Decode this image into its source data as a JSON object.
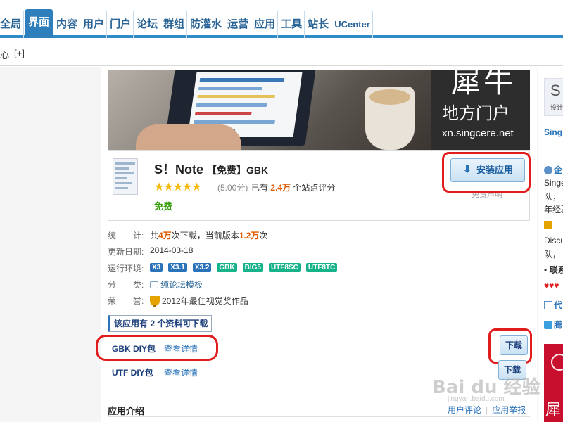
{
  "nav": {
    "tabs": [
      "全局",
      "界面",
      "内容",
      "用户",
      "门户",
      "论坛",
      "群组",
      "防灌水",
      "运营",
      "应用",
      "工具",
      "站长",
      "UCenter"
    ],
    "active": "界面"
  },
  "subbar": {
    "text": "心",
    "plus": "[+]"
  },
  "banner": {
    "title_big": "犀牛",
    "title_sub": "地方门户",
    "url": "xn.singcere.net"
  },
  "app": {
    "name": "S！Note",
    "tag": "【免费】GBK",
    "stars": "★★★★★",
    "score": "(5.00分)",
    "rated_prefix": "已有",
    "rated_count": "2.4万",
    "rated_suffix": "个站点评分",
    "price": "免费",
    "install_label": "安装应用",
    "disclaimer": "免责声明"
  },
  "info": {
    "stats_label": "统　　计:",
    "stats_v1": "共",
    "stats_downloads": "4万",
    "stats_v2": "次下载，当前版本",
    "stats_version": "1.2万",
    "stats_v3": "次",
    "date_label": "更新日期:",
    "date": "2014-03-18",
    "env_label": "运行环境:",
    "env": [
      "X3",
      "X3.1",
      "X3.2",
      "GBK",
      "BIG5",
      "UTF8SC",
      "UTF8TC"
    ],
    "cat_label": "分　　类:",
    "category": "纯论坛模板",
    "honor_label": "荣　　誉:",
    "honor": "2012年最佳视觉奖作品"
  },
  "downloads": {
    "header": "该应用有 2 个资料可下载",
    "items": [
      {
        "name": "GBK DIY包",
        "link": "查看详情",
        "button": "下载"
      },
      {
        "name": "UTF DIY包",
        "link": "查看详情",
        "button": "下载"
      }
    ]
  },
  "intro": {
    "title": "应用介绍",
    "link1": "用户评论",
    "link2": "应用举报"
  },
  "sidebar": {
    "logo_letter": "S",
    "logo_sub": "设计",
    "items": [
      "Sing",
      "企",
      "Singe",
      "队，",
      "年经验",
      "Discu",
      "队，",
      "联系",
      "代",
      "腾"
    ],
    "banner_text": "犀"
  },
  "watermark": {
    "main": "Bai du 经验",
    "sub": "jingyan.baidu.com"
  },
  "colors": {
    "nav_active": "#2f7fbc",
    "nav_border": "#2e8bc5",
    "highlight": "#e01c1c",
    "accent_red": "#e25a00",
    "free_green": "#2d9a00"
  }
}
